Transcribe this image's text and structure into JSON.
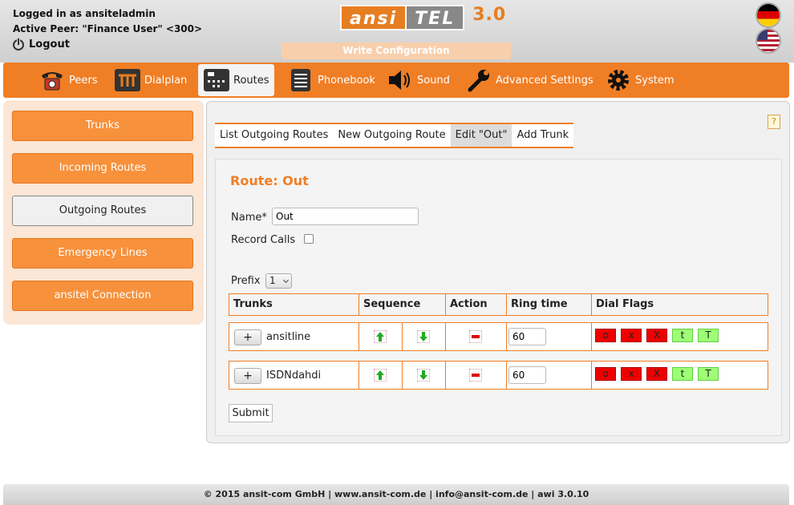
{
  "header": {
    "logged_in": "Logged in as ansiteladmin",
    "active_peer": "Active Peer: \"Finance User\" <300>",
    "logout": "Logout",
    "logo_ansi": "ansi",
    "logo_tel": "TEL",
    "logo_version": "3.0",
    "write_config": "Write Configuration",
    "languages": [
      "de",
      "en"
    ]
  },
  "nav": {
    "items": [
      {
        "label": "Peers",
        "icon": "phone-icon"
      },
      {
        "label": "Dialplan",
        "icon": "dialplan-icon"
      },
      {
        "label": "Routes",
        "icon": "routes-icon",
        "active": true
      },
      {
        "label": "Phonebook",
        "icon": "phonebook-icon"
      },
      {
        "label": "Sound",
        "icon": "speaker-icon"
      },
      {
        "label": "Advanced Settings",
        "icon": "wrench-icon"
      },
      {
        "label": "System",
        "icon": "gear-icon"
      }
    ]
  },
  "sidebar": {
    "items": [
      {
        "label": "Trunks"
      },
      {
        "label": "Incoming Routes"
      },
      {
        "label": "Outgoing Routes",
        "active": true
      },
      {
        "label": "Emergency Lines"
      },
      {
        "label": "ansitel Connection"
      }
    ]
  },
  "main": {
    "help": "?",
    "tabs": [
      {
        "label": "List Outgoing Routes"
      },
      {
        "label": "New Outgoing Route"
      },
      {
        "label": "Edit \"Out\"",
        "active": true
      },
      {
        "label": "Add Trunk"
      }
    ],
    "title": "Route: Out",
    "name_label": "Name",
    "name_required": "*",
    "name_value": "Out",
    "record_label": "Record Calls",
    "record_checked": false,
    "prefix_label": "Prefix",
    "prefix_value": "1",
    "table": {
      "headers": [
        "Trunks",
        "Sequence",
        "Action",
        "Ring time",
        "Dial Flags"
      ],
      "rows": [
        {
          "plus": "+",
          "name": "ansitline",
          "ring": "60"
        },
        {
          "plus": "+",
          "name": "ISDNdahdi",
          "ring": "60"
        }
      ],
      "flags": [
        {
          "label": "o",
          "color": "#ee0000"
        },
        {
          "label": "x",
          "color": "#ee0000"
        },
        {
          "label": "X",
          "color": "#ee0000"
        },
        {
          "label": "t",
          "color": "#9dff74"
        },
        {
          "label": "T",
          "color": "#9dff74"
        }
      ]
    },
    "submit": "Submit"
  },
  "footer": "© 2015 ansit-com GmbH | www.ansit-com.de | info@ansit-com.de | awi 3.0.10",
  "colors": {
    "accent": "#f07e25",
    "sidebar_bg": "#fce6d6"
  }
}
